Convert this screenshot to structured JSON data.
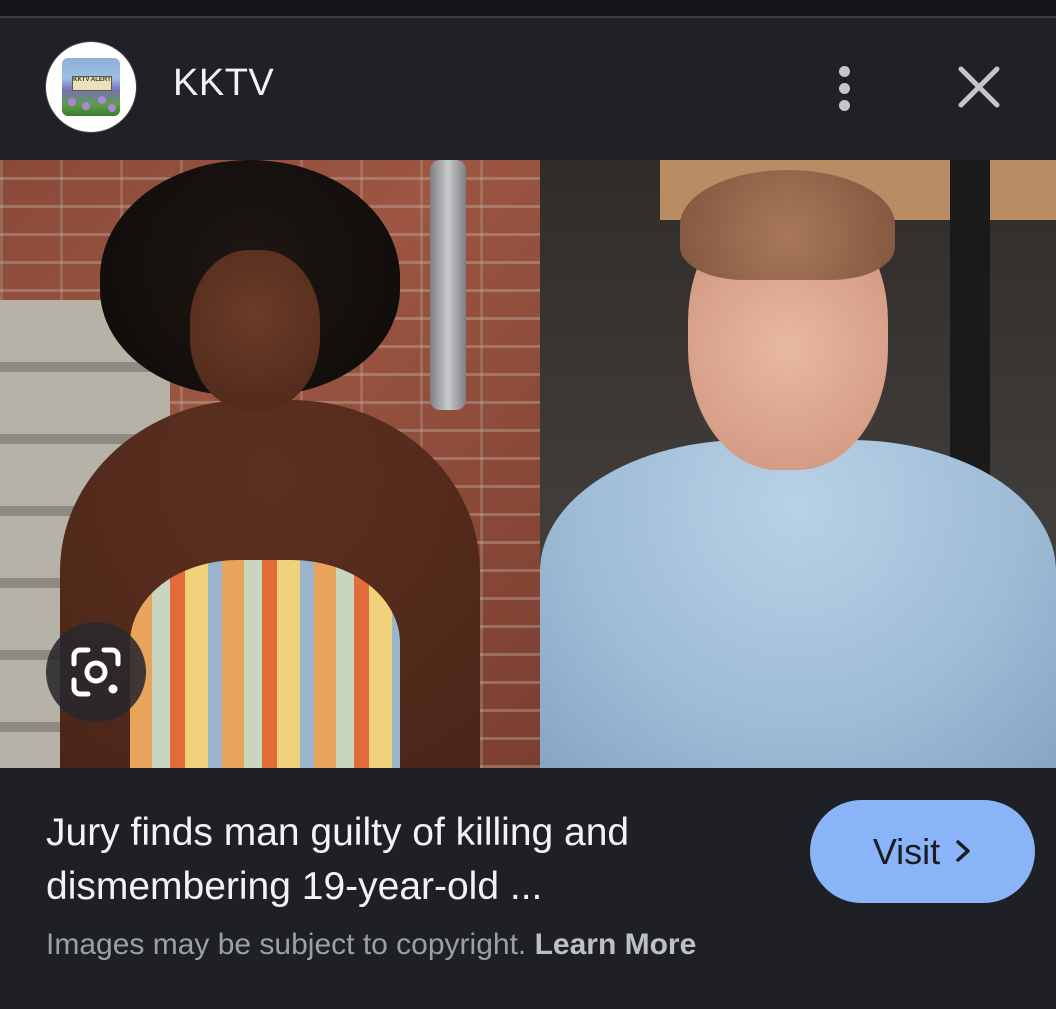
{
  "source": {
    "name": "KKTV",
    "logo_text": "KKTV ALERT"
  },
  "icons": {
    "more": "more-vert-icon",
    "close": "close-icon",
    "lens": "google-lens-icon",
    "visit_chevron": "chevron-right-icon"
  },
  "result": {
    "title": "Jury finds man guilty of killing and dismembering 19-year-old ...",
    "visit_label": "Visit",
    "visit_chevron": "›"
  },
  "footer": {
    "copyright_text": "Images may be subject to copyright.",
    "learn_more": "Learn More"
  },
  "colors": {
    "background": "#1f2025",
    "accent": "#8ab4f8",
    "text_primary": "#f1f3f4",
    "text_secondary": "#9aa0a6"
  }
}
